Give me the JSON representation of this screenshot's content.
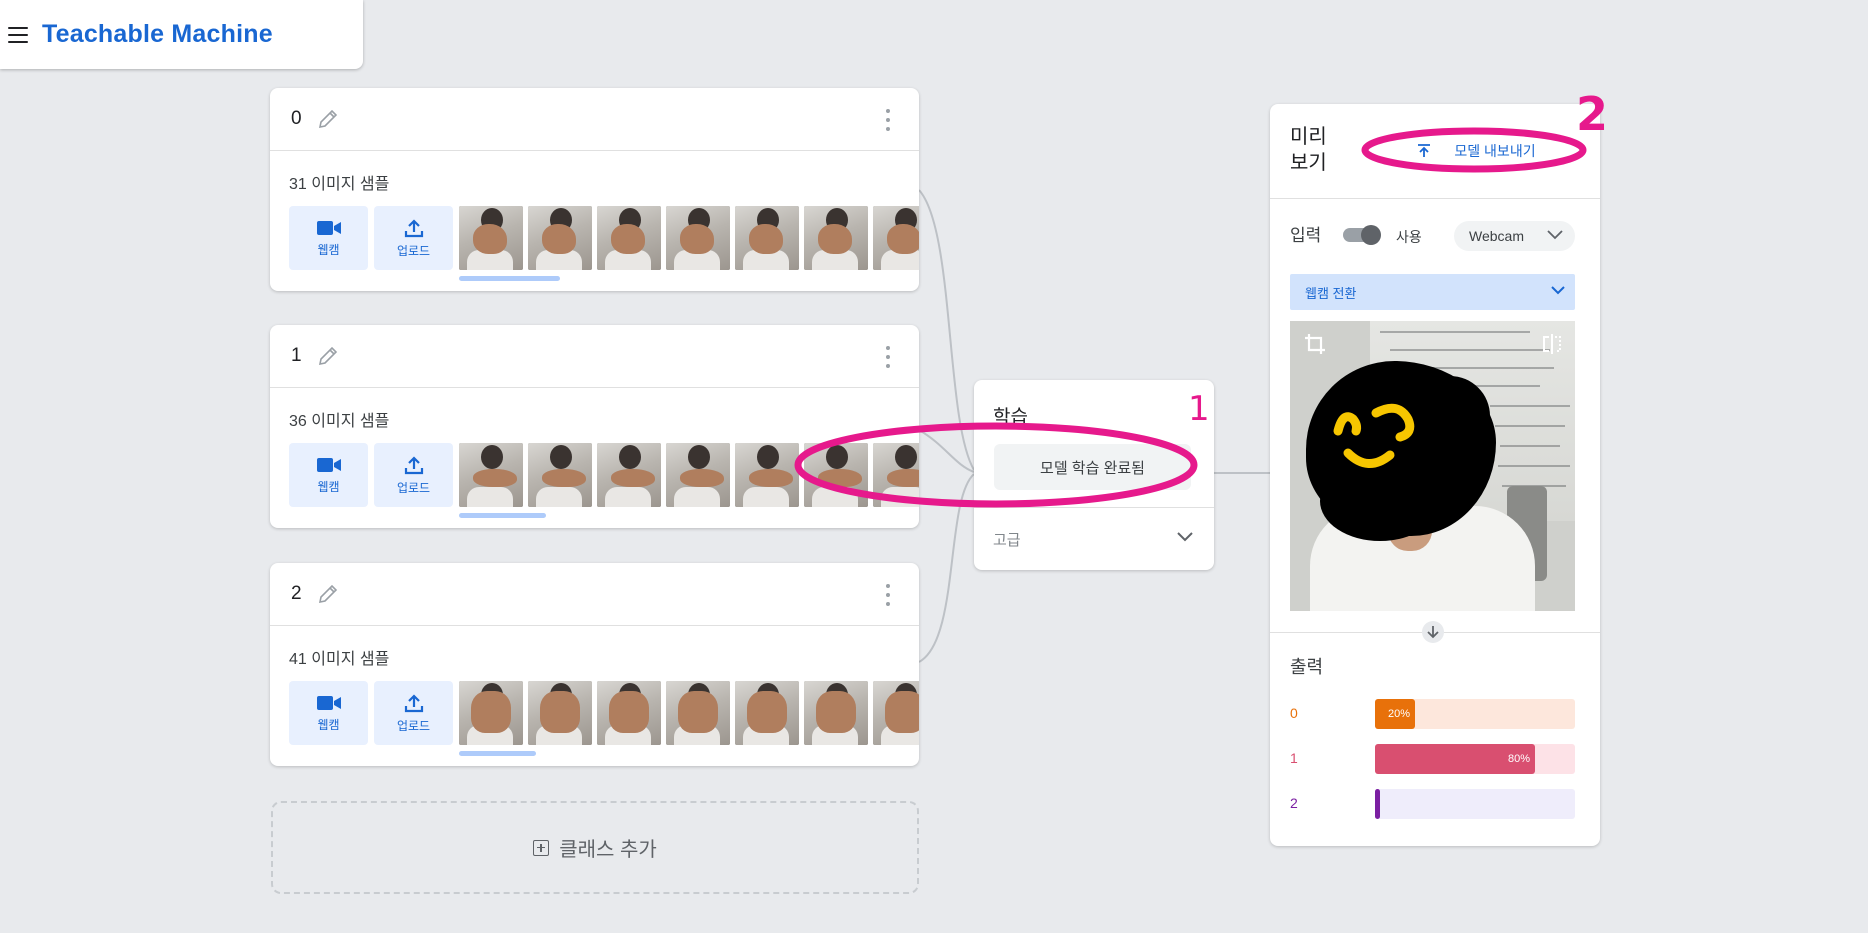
{
  "app": {
    "title": "Teachable Machine"
  },
  "classes": [
    {
      "name": "0",
      "count": "31",
      "sample_label": "이미지 샘플",
      "webcam_label": "웹캠",
      "upload_label": "업로드",
      "pose": "fist"
    },
    {
      "name": "1",
      "count": "36",
      "sample_label": "이미지 샘플",
      "webcam_label": "웹캠",
      "upload_label": "업로드",
      "pose": "gun"
    },
    {
      "name": "2",
      "count": "41",
      "sample_label": "이미지 샘플",
      "webcam_label": "웹캠",
      "upload_label": "업로드",
      "pose": "palm"
    }
  ],
  "add_class": {
    "label": "클래스 추가"
  },
  "training": {
    "title": "학습",
    "button_label": "모델 학습 완료됨",
    "advanced_label": "고급"
  },
  "preview": {
    "title": "미리 보기",
    "export_label": "모델 내보내기",
    "input_label": "입력",
    "toggle_label": "사용",
    "toggle_on": true,
    "source_select": "Webcam",
    "switch_label": "웹캠 전환",
    "output_label": "출력",
    "outputs": [
      {
        "name": "0",
        "percent": 20,
        "percent_label": "20%",
        "color": "#e8710a",
        "track_color": "#fde7dc"
      },
      {
        "name": "1",
        "percent": 80,
        "percent_label": "80%",
        "color": "#d94f70",
        "track_color": "#fde2e7"
      },
      {
        "name": "2",
        "percent": 0,
        "percent_label": "",
        "color": "#7b1fa2",
        "track_color": "#efedfb"
      }
    ]
  },
  "annotations": {
    "mark1": "1",
    "mark2": "2",
    "color": "#e6198c"
  },
  "colors": {
    "accent": "#1967d2",
    "background": "#e8eaed"
  }
}
